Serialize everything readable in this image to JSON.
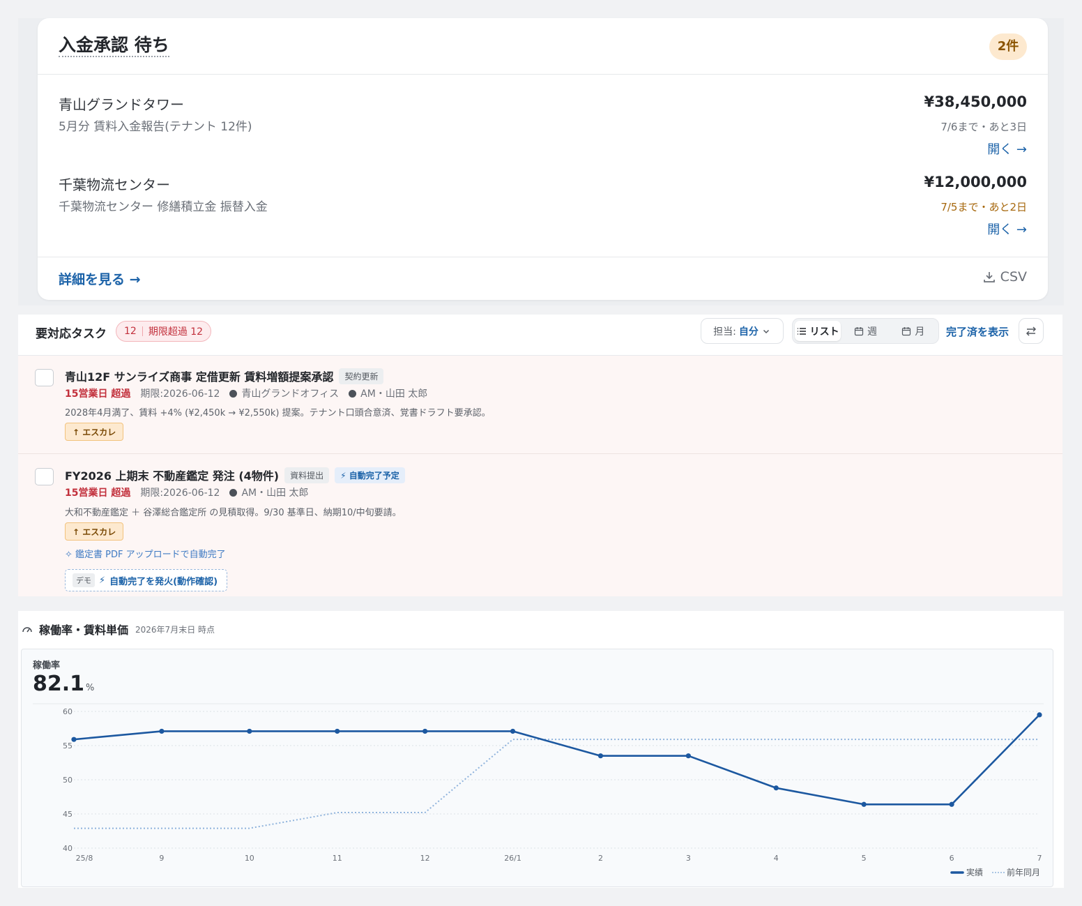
{
  "approval": {
    "title": "入金承認 待ち",
    "count": "2件",
    "items": [
      {
        "name": "青山グランドタワー",
        "desc": "5月分 賃料入金報告(テナント 12件)",
        "amount": "¥38,450,000",
        "due": "7/6まで・あと3日",
        "open": "開く →"
      },
      {
        "name": "千葉物流センター",
        "desc": "千葉物流センター 修繕積立金 振替入金",
        "amount": "¥12,000,000",
        "due": "7/5まで・あと2日",
        "open": "開く →"
      }
    ],
    "detail_link": "詳細を見る →",
    "csv_label": "CSV"
  },
  "tasks": {
    "title": "要対応タスク",
    "count": "12",
    "overdue_label": "期限超過 12",
    "assignee_prefix": "担当:",
    "assignee_value": "自分",
    "views": [
      "リスト",
      "週",
      "月"
    ],
    "show_done": "完了済を表示",
    "items": [
      {
        "title": "青山12F サンライズ商事 定借更新 賃料増額提案承認",
        "tags": [
          "契約更新"
        ],
        "overdue": "15営業日 超過",
        "due": "期限:2026-06-12",
        "property": "青山グランドオフィス",
        "owner": "AM・山田 太郎",
        "note": "2028年4月満了、賃料 +4% (¥2,450k → ¥2,550k) 提案。テナント口頭合意済、覚書ドラフト要承認。",
        "escalation": "↑ エスカレ"
      },
      {
        "title": "FY2026 上期末 不動産鑑定 発注 (4物件)",
        "tags": [
          "資料提出"
        ],
        "auto_tag": "自動完了予定",
        "overdue": "15営業日 超過",
        "due": "期限:2026-06-12",
        "owner": "AM・山田 太郎",
        "note": "大和不動産鑑定 ＋ 谷澤総合鑑定所 の見積取得。9/30 基準日、納期10/中旬要請。",
        "escalation": "↑ エスカレ",
        "auto_hint": "鑑定書 PDF アップロードで自動完了",
        "demo_tag": "デモ",
        "demo_label": "自動完了を発火(動作確認)"
      }
    ]
  },
  "occupancy": {
    "title": "稼働率・賃料単価",
    "as_of": "2026年7月末日 時点",
    "metric_label": "稼働率",
    "metric_value": "82.1",
    "metric_unit": "%"
  },
  "colors": {
    "accent": "#1b62a8",
    "danger": "#c2303c",
    "warning_bg": "#fde9cf",
    "series_actual": "#1c58a0",
    "series_prev": "#8fb3dc"
  },
  "chart_data": {
    "type": "line",
    "categories": [
      "25/8",
      "9",
      "10",
      "11",
      "12",
      "26/1",
      "2",
      "3",
      "4",
      "5",
      "6",
      "7"
    ],
    "series": [
      {
        "name": "実績",
        "values": [
          55.9,
          57.1,
          57.1,
          57.1,
          57.1,
          57.1,
          53.5,
          53.5,
          48.8,
          46.4,
          46.4,
          59.5
        ],
        "style": "solid"
      },
      {
        "name": "前年同月",
        "values": [
          42.9,
          42.9,
          42.9,
          45.2,
          45.2,
          55.9,
          55.9,
          55.9,
          55.9,
          55.9,
          55.9,
          55.9
        ],
        "style": "dotted"
      }
    ],
    "ylim": [
      40,
      60
    ],
    "yticks": [
      40,
      45,
      50,
      55,
      60
    ],
    "grid": true,
    "legend": "bottom-right"
  }
}
